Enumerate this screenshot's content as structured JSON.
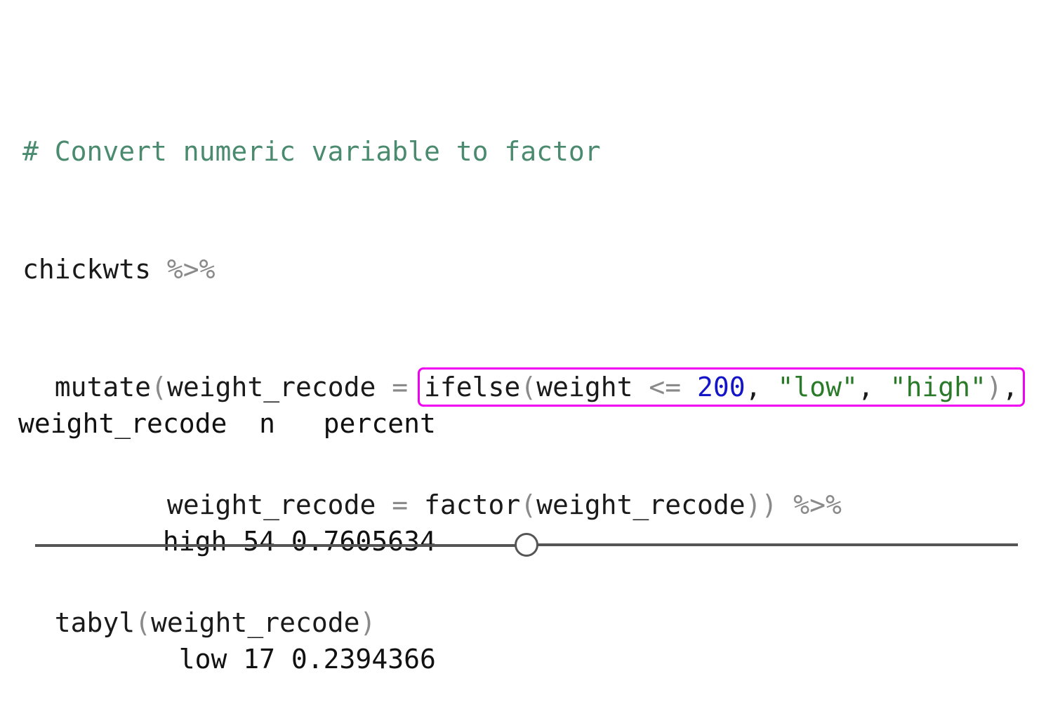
{
  "code": {
    "comment": "# Convert numeric variable to factor",
    "line2": {
      "ident": "chickwts",
      "pipe": "%>%"
    },
    "line3": {
      "indent": "  ",
      "func": "mutate",
      "open": "(",
      "ident": "weight_recode",
      "eq": "=",
      "highlight": {
        "func": "ifelse",
        "open": "(",
        "ident": "weight",
        "op": "<=",
        "num": "200",
        "comma1": ",",
        "str1": "\"low\"",
        "comma2": ",",
        "str2": "\"high\"",
        "close": ")",
        "comma3": ","
      }
    },
    "line4": {
      "indent": "         ",
      "ident": "weight_recode",
      "eq": "=",
      "func": "factor",
      "open": "(",
      "arg": "weight_recode",
      "close": "))",
      "pipe": "%>%"
    },
    "line5": {
      "indent": "  ",
      "func": "tabyl",
      "open": "(",
      "arg": "weight_recode",
      "close": ")"
    }
  },
  "output": {
    "header": "weight_recode  n   percent",
    "rows": [
      "         high 54 0.7605634",
      "          low 17 0.2394366"
    ]
  },
  "slider": {
    "position": 0.5
  },
  "colors": {
    "highlight_border": "#f000f0",
    "comment": "#4a8a6e",
    "number": "#1515c8",
    "string": "#2a7a2a",
    "operator": "#8a8a8a"
  }
}
